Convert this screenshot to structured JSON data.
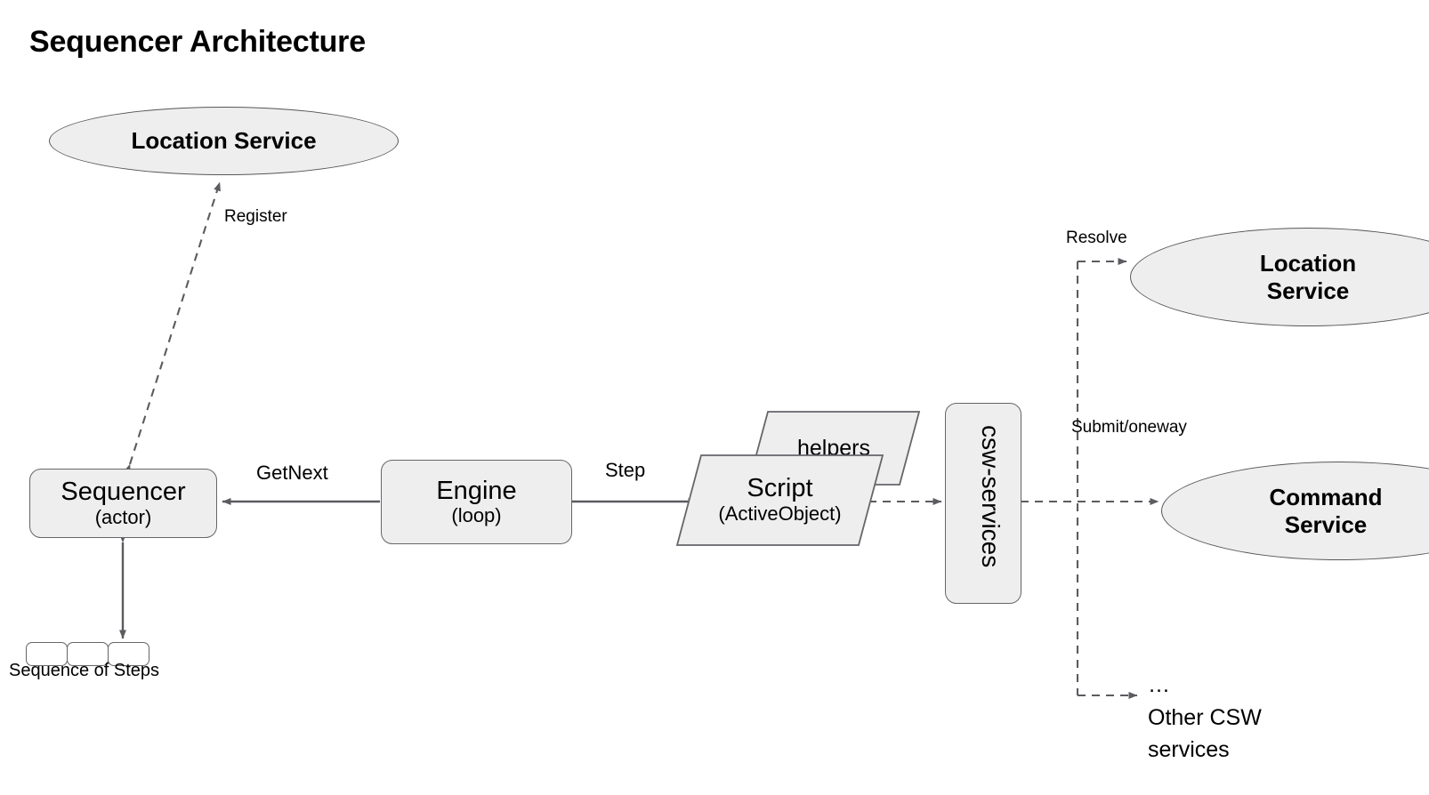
{
  "diagram": {
    "title": "Sequencer Architecture",
    "background": "#ffffff",
    "node_fill": "#eeeeee",
    "node_stroke": "#66666b",
    "edge_color": "#5b5b60",
    "text_color": "#000000"
  },
  "nodes": {
    "location_service_left": {
      "label": "Location Service",
      "shape": "ellipse"
    },
    "sequencer": {
      "label": "Sequencer",
      "sublabel": "(actor)",
      "shape": "rounded-rect"
    },
    "engine": {
      "label": "Engine",
      "sublabel": "(loop)",
      "shape": "rounded-rect"
    },
    "script": {
      "label": "Script",
      "sublabel": "(ActiveObject)",
      "shape": "parallelogram"
    },
    "helpers": {
      "label": "helpers",
      "shape": "parallelogram"
    },
    "csw_services": {
      "label": "csw-services",
      "shape": "rounded-rect-vertical"
    },
    "location_service_right": {
      "label_line1": "Location",
      "label_line2": "Service",
      "shape": "ellipse"
    },
    "command_service": {
      "label_line1": "Command",
      "label_line2": "Service",
      "shape": "ellipse"
    },
    "other_csw_services": {
      "ellipsis": "…",
      "label_line1": "Other CSW",
      "label_line2": "services",
      "shape": "text"
    },
    "steps": {
      "caption": "Sequence of Steps",
      "count": 3
    }
  },
  "edges": {
    "register": {
      "label": "Register",
      "style": "dashed",
      "arrows": "both"
    },
    "get_next": {
      "label": "GetNext",
      "style": "solid",
      "arrows": "end"
    },
    "step": {
      "label": "Step",
      "style": "solid",
      "arrows": "end"
    },
    "script_csw": {
      "label": "",
      "style": "dashed",
      "arrows": "both"
    },
    "resolve": {
      "label": "Resolve",
      "style": "dashed",
      "arrows": "end"
    },
    "submit_oneway": {
      "label": "Submit/oneway",
      "style": "dashed",
      "arrows": "end"
    },
    "other": {
      "label": "",
      "style": "dashed",
      "arrows": "end"
    },
    "sequencer_steps": {
      "label": "",
      "style": "solid",
      "arrows": "both"
    }
  }
}
